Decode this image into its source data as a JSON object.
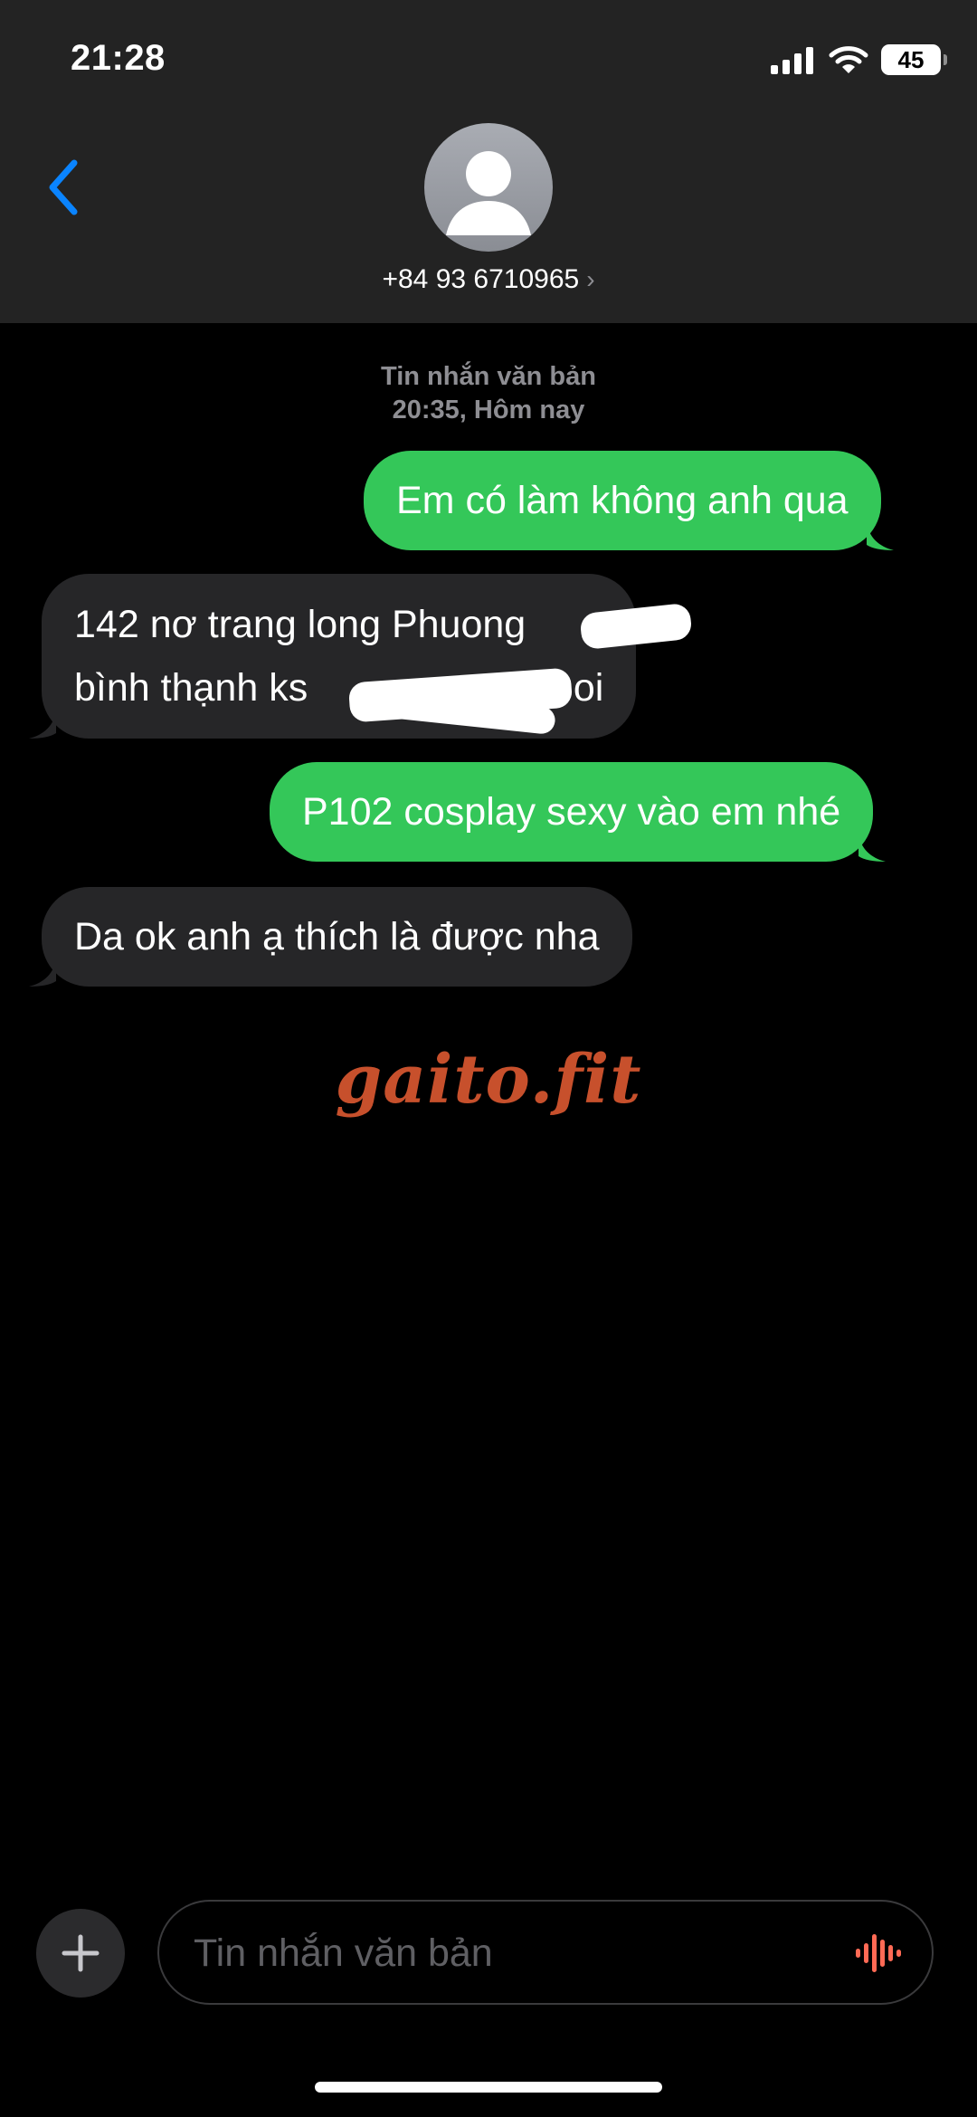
{
  "status_bar": {
    "time": "21:28",
    "battery": "45"
  },
  "header": {
    "contact": "+84 93 6710965",
    "chevron": "›"
  },
  "conversation": {
    "meta_label": "Tin nhắn văn bản",
    "meta_time": "20:35, Hôm nay",
    "messages": [
      {
        "direction": "sent",
        "text": "Em có làm không anh qua"
      },
      {
        "direction": "received",
        "line1": "142 nơ trang long Phuong",
        "line2_a": "bình thạnh ks",
        "line2_b": "anh oi"
      },
      {
        "direction": "sent",
        "text": "P102 cosplay sexy vào em nhé"
      },
      {
        "direction": "received",
        "text": "Da ok anh ạ thích là được nha"
      }
    ]
  },
  "watermark": "gaito.fit",
  "composer": {
    "placeholder": "Tin nhắn văn bản",
    "plus": "+"
  },
  "icons": {
    "back": "chevron-left-icon",
    "mic": "waveform-icon",
    "signal": "cellular-signal-icon",
    "wifi": "wifi-icon"
  },
  "colors": {
    "sent_bubble": "#34c759",
    "received_bubble": "#262628",
    "accent": "#0a84ff",
    "watermark": "#c7502c",
    "mic": "#ff6a55"
  }
}
